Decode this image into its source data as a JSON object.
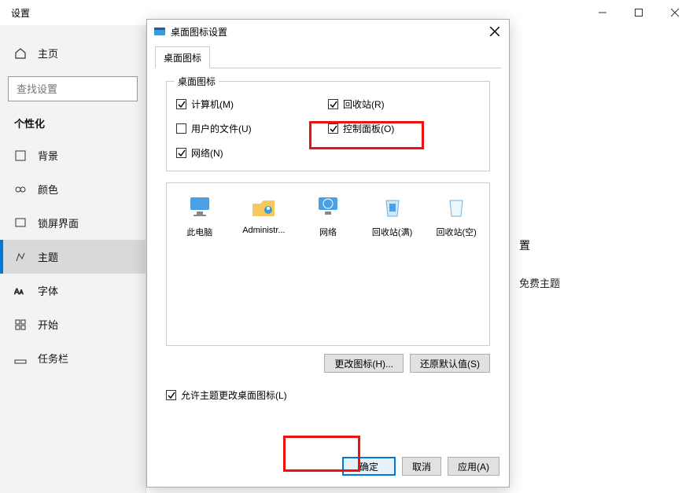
{
  "settings": {
    "window_title": "设置",
    "home_label": "主页",
    "search_placeholder": "查找设置",
    "category": "个性化",
    "nav": [
      "背景",
      "颜色",
      "锁屏界面",
      "主题",
      "字体",
      "开始",
      "任务栏"
    ],
    "active_nav_index": 3,
    "main_peek_title": "置",
    "main_peek_sub": "免费主题"
  },
  "dialog": {
    "title": "桌面图标设置",
    "tab": "桌面图标",
    "group_label": "桌面图标",
    "checks": {
      "computer": {
        "label": "计算机(M)",
        "checked": true
      },
      "recycle": {
        "label": "回收站(R)",
        "checked": true
      },
      "user": {
        "label": "用户的文件(U)",
        "checked": false
      },
      "control": {
        "label": "控制面板(O)",
        "checked": true
      },
      "network": {
        "label": "网络(N)",
        "checked": true
      }
    },
    "preview": [
      "此电脑",
      "Administr...",
      "网络",
      "回收站(满)",
      "回收站(空)"
    ],
    "change_icon": "更改图标(H)...",
    "restore_defaults": "还原默认值(S)",
    "allow_themes": "允许主题更改桌面图标(L)",
    "allow_themes_checked": true,
    "ok": "确定",
    "cancel": "取消",
    "apply": "应用(A)"
  }
}
